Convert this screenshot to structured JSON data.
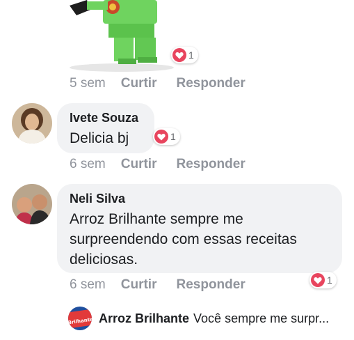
{
  "post_image": {
    "reaction_count": "1"
  },
  "post_image_meta": {
    "time": "5 sem",
    "like_label": "Curtir",
    "reply_label": "Responder"
  },
  "comments": [
    {
      "author": "Ivete Souza",
      "text": "Delicia bj",
      "reaction_count": "1",
      "time": "6 sem",
      "like_label": "Curtir",
      "reply_label": "Responder"
    },
    {
      "author": "Neli Silva",
      "text": "Arroz Brilhante sempre me surpreendendo com essas receitas deliciosas.",
      "reaction_count": "1",
      "time": "6 sem",
      "like_label": "Curtir",
      "reply_label": "Responder"
    }
  ],
  "reply_preview": {
    "author": "Arroz Brilhante",
    "text": "Você sempre me surpr...",
    "logo_text": "Brilhante"
  },
  "colors": {
    "reaction_heart": "#e8455e",
    "meta_gray": "#90949c",
    "bubble_bg": "#f1f2f4",
    "brand_blue": "#1f4f9e"
  }
}
